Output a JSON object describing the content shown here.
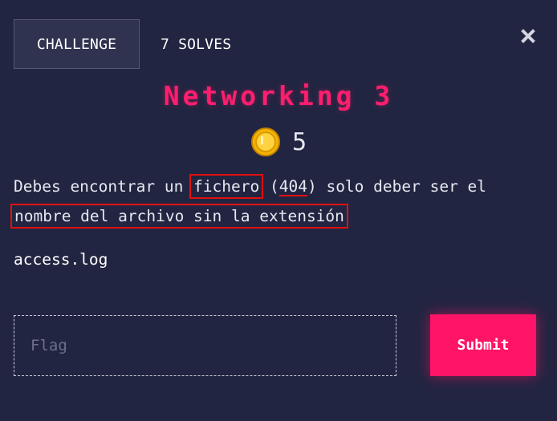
{
  "header": {
    "tabs": [
      {
        "label": "CHALLENGE",
        "active": true
      },
      {
        "label": "7 SOLVES",
        "active": false
      }
    ],
    "close_icon": "close-icon"
  },
  "challenge": {
    "title": "Networking 3",
    "value": "5",
    "coin_icon": "coin-icon",
    "description": {
      "part1": "Debes encontrar un ",
      "highlight1": "fichero",
      "part2": " (",
      "highlight2": "404",
      "part3": ") solo deber ser el",
      "highlight3": "nombre del archivo sin la extensión"
    },
    "file_name": "access.log"
  },
  "form": {
    "flag_placeholder": "Flag",
    "flag_value": "",
    "submit_label": "Submit"
  },
  "colors": {
    "background": "#222541",
    "accent": "#ff1467",
    "annotation": "#e11010"
  }
}
